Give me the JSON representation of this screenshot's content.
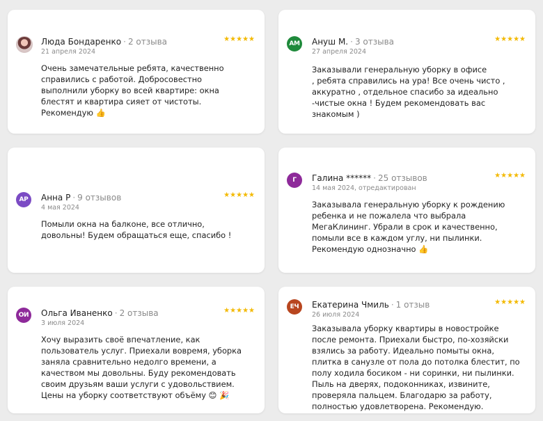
{
  "reviews": [
    {
      "author": "Люда Бондаренко",
      "count": "2 отзыва",
      "date": "21 апреля 2024",
      "stars": "★★★★★",
      "avatar_initials": "",
      "avatar_color": "#d9c7c6",
      "lines": [
        "Очень замечательные ребята, качественно",
        "справились с работой. Добросовестно",
        "выполнили уборку во всей квартире: окна",
        "блестят и квартира сияет от чистоты.",
        "Рекомендую 👍"
      ]
    },
    {
      "author": "Ануш М.",
      "count": "3 отзыва",
      "date": "27 апреля 2024",
      "stars": "★★★★★",
      "avatar_initials": "АМ",
      "avatar_color": "#1f8a3b",
      "lines": [
        "Заказывали генеральную уборку в офисе",
        ", ребята справились на ура! Все очень чисто ,",
        "аккуратно , отдельное спасибо за идеально",
        "-чистые окна ! Будем рекомендовать вас",
        "знакомым )"
      ]
    },
    {
      "author": "Анна Р",
      "count": "9 отзывов",
      "date": "4 мая 2024",
      "stars": "★★★★★",
      "avatar_initials": "АР",
      "avatar_color": "#7b4bc4",
      "lines": [
        "Помыли окна на балконе, все отлично,",
        "довольны! Будем обращаться еще, спасибо !"
      ]
    },
    {
      "author": "Галина ******",
      "count": "25 отзывов",
      "date": "14 мая 2024, отредактирован",
      "stars": "★★★★★",
      "avatar_initials": "Г",
      "avatar_color": "#8e2a9a",
      "lines": [
        "Заказывала генеральную уборку к рождению",
        "ребенка и не пожалела что выбрала",
        "МегаКлининг. Убрали в срок и качественно,",
        "помыли все в каждом углу, ни пылинки.",
        "Рекомендую однозначно 👍"
      ]
    },
    {
      "author": "Ольга Иваненко",
      "count": "2 отзыва",
      "date": "3 июля 2024",
      "stars": "★★★★★",
      "avatar_initials": "ОИ",
      "avatar_color": "#8e2a9a",
      "lines": [
        "Хочу выразить своё впечатление, как",
        "пользователь услуг. Приехали вовремя, уборка",
        "заняла сравнительно недолго времени, а",
        "качеством мы довольны. Буду рекомендовать",
        "своим друзьям ваши услуги с удовольствием.",
        "Цены на уборку соответствуют объёму 😊 🎉"
      ]
    },
    {
      "author": "Екатерина Чмиль",
      "count": "1 отзыв",
      "date": "26 июля 2024",
      "stars": "★★★★★",
      "avatar_initials": "ЕЧ",
      "avatar_color": "#b8461f",
      "lines": [
        "Заказывала уборку квартиры в новостройке",
        "после ремонта. Приехали быстро, по-хозяйски",
        "взялись за работу. Идеально помыты окна,",
        "плитка в санузле от пола до потолка блестит, по",
        "полу ходила босиком - ни соринки, ни пылинки.",
        "Пыль на дверях, подоконниках, извините,",
        "проверяла пальцем. Благодарю за работу,",
        "полностью удовлетворена. Рекомендую."
      ]
    }
  ],
  "separator": "·"
}
